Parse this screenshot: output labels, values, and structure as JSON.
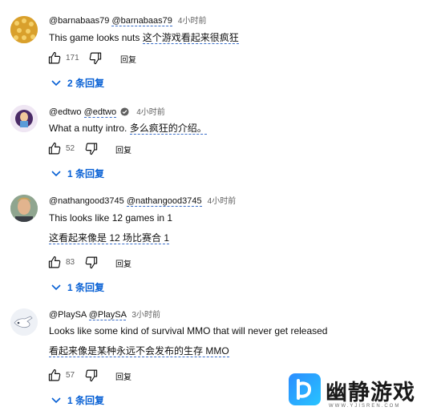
{
  "comments": [
    {
      "handle": "@barnabaas79",
      "handle_translated": "@barnabaas79",
      "time": "4小时前",
      "lines": [
        {
          "original": "This game looks nuts",
          "translated": "这个游戏看起来很疯狂"
        }
      ],
      "likes": "171",
      "reply_label": "回复",
      "replies_label": "2 条回复"
    },
    {
      "handle": "@edtwo",
      "handle_translated": "@edtwo",
      "verified": true,
      "time": "4小时前",
      "lines": [
        {
          "original": "What a nutty intro.",
          "translated": "多么疯狂的介绍。"
        }
      ],
      "likes": "52",
      "reply_label": "回复",
      "replies_label": "1 条回复"
    },
    {
      "handle": "@nathangood3745",
      "handle_translated": "@nathangood3745",
      "time": "4小时前",
      "lines": [
        {
          "original": "This looks like 12 games in 1"
        },
        {
          "translated": "这看起来像是 12 场比赛合 1"
        }
      ],
      "likes": "83",
      "reply_label": "回复",
      "replies_label": "1 条回复"
    },
    {
      "handle": "@PlaySA",
      "handle_translated": "@PlaySA",
      "time": "3小时前",
      "lines": [
        {
          "original": "Looks like some kind of survival MMO that will never get released"
        },
        {
          "translated": "看起来像是某种永远不会发布的生存 MMO"
        }
      ],
      "likes": "57",
      "reply_label": "回复",
      "replies_label": "1 条回复"
    }
  ],
  "watermark": {
    "name": "幽静游戏",
    "url": "WWW.YJISREN.COM"
  },
  "colors": {
    "link": "#065fd4",
    "secondary_text": "#606060",
    "translation_underline": "#3a6ec8"
  }
}
